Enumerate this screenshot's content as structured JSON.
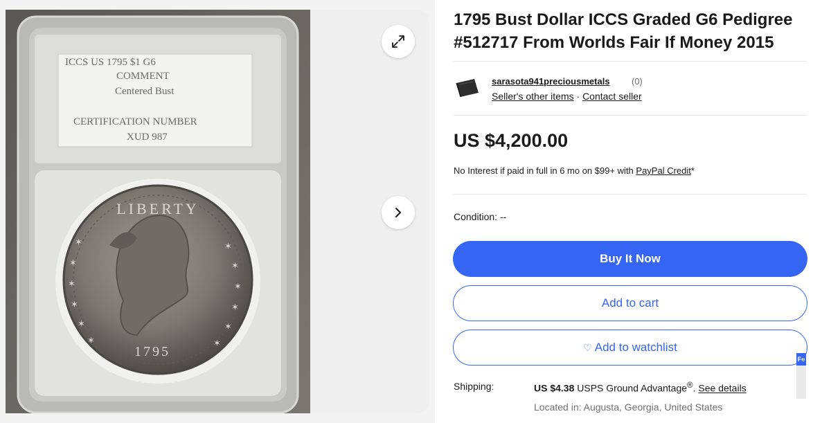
{
  "listing": {
    "title": "1795 Bust Dollar ICCS Graded G6 Pedigree #512717 From Worlds Fair If Money 2015"
  },
  "gallery": {
    "expand_icon": "expand-icon",
    "next_icon": "chevron-right-icon"
  },
  "slab_label": {
    "line1": "ICCS     US 1795 $1 G6",
    "line2": "COMMENT",
    "line3": "Centered Bust",
    "line4": "CERTIFICATION NUMBER",
    "line5": "XUD 987"
  },
  "coin": {
    "legend": "LIBERTY",
    "date": "1795"
  },
  "seller": {
    "name": "sarasota941preciousmetals",
    "feedback_count": "(0)",
    "other_items_label": "Seller's other items",
    "separator": "·",
    "contact_label": "Contact seller"
  },
  "price": {
    "amount": "US $4,200.00",
    "financing_text": "No Interest if paid in full in 6 mo on $99+ with ",
    "financing_link": "PayPal Credit",
    "financing_suffix": "*"
  },
  "condition": {
    "label": "Condition:",
    "value": "--"
  },
  "actions": {
    "buy_now": "Buy It Now",
    "add_to_cart": "Add to cart",
    "add_to_watchlist": "Add to watchlist"
  },
  "feedback_tab": {
    "label": "Fe"
  },
  "shipping": {
    "label": "Shipping:",
    "amount": "US $4.38",
    "service": "USPS Ground Advantage",
    "service_mark": "®",
    "details_link": "See details",
    "location": "Located in: Augusta, Georgia, United States"
  },
  "colors": {
    "primary": "#3665f3",
    "text": "#191919",
    "muted": "#707070"
  }
}
